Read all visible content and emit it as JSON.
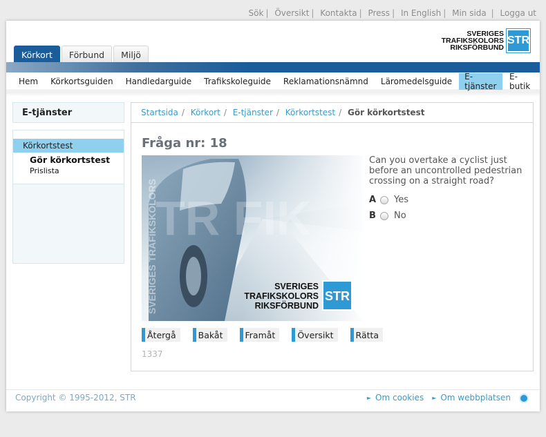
{
  "toplinks": [
    "Sök",
    "Översikt",
    "Kontakta",
    "Press",
    "In English",
    "Min sida",
    "Logga ut"
  ],
  "logo": {
    "line1": "SVERIGES",
    "line2": "TRAFIKSKOLORS",
    "line3": "RIKSFÖRBUND",
    "badge": "STR"
  },
  "section_tabs": [
    "Körkort",
    "Förbund",
    "Miljö"
  ],
  "main_nav": [
    "Hem",
    "Körkortsguiden",
    "Handledarguide",
    "Trafikskoleguide",
    "Reklamationsnämnd",
    "Läromedelsguide",
    "E-tjänster",
    "E-butik"
  ],
  "sidebar": {
    "title": "E-tjänster",
    "selected": "Körkortstest",
    "sub_bold": "Gör körkortstest",
    "sub_plain": "Prislista"
  },
  "breadcrumb": [
    "Startsida",
    "Körkort",
    "E-tjänster",
    "Körkortstest",
    "Gör körkortstest"
  ],
  "question": {
    "title": "Fråga nr: 18",
    "text": "Can you overtake a cyclist just before an uncontrolled pedestrian crossing on a straight road?",
    "answers": [
      {
        "letter": "A",
        "label": "Yes"
      },
      {
        "letter": "B",
        "label": "No"
      }
    ],
    "number": "1337"
  },
  "photo": {
    "watermark": "SVERIGES TRAFIKSKOLORS",
    "logo_l1": "SVERIGES",
    "logo_l2": "TRAFIKSKOLORS",
    "logo_l3": "RIKSFÖRBUND",
    "logo_badge": "STR"
  },
  "buttons": [
    "Återgå",
    "Bakåt",
    "Framåt",
    "Översikt",
    "Rätta"
  ],
  "footer": {
    "copyright": "Copyright © 1995-2012, STR",
    "link1": "Om cookies",
    "link2": "Om webbplatsen"
  }
}
